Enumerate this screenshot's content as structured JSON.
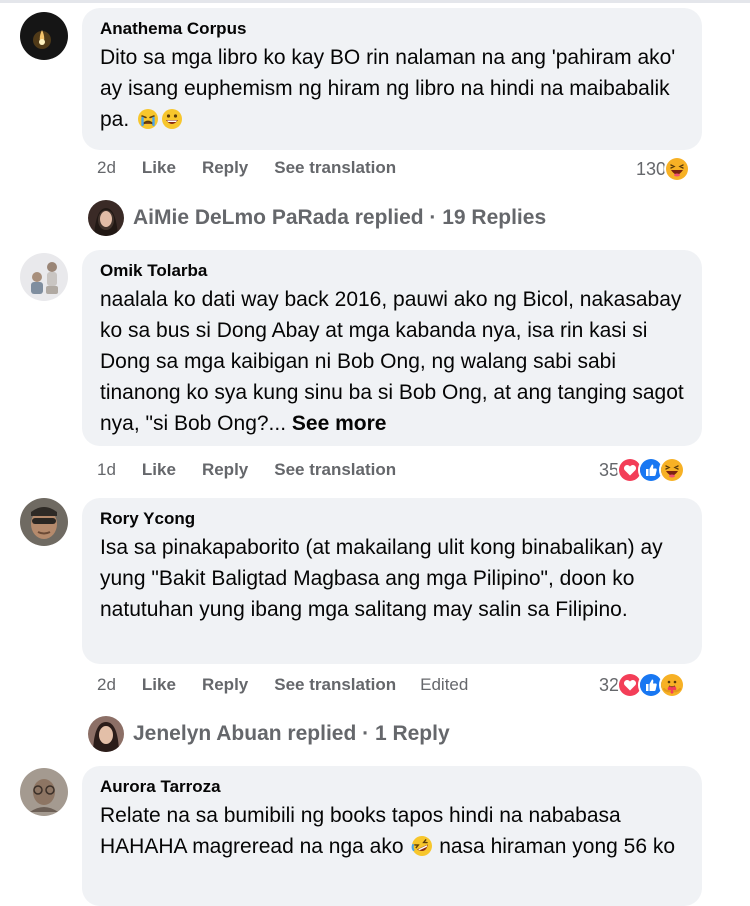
{
  "comments": [
    {
      "author": "Anathema Corpus",
      "text": "Dito sa mga libro ko kay BO rin nalaman na ang 'pahiram ako' ay isang euphemism ng hiram ng libro na hindi na maibabalik pa.",
      "text_emojis": [
        "crying-face",
        "grinning-face"
      ],
      "time": "2d",
      "like_label": "Like",
      "reply_label": "Reply",
      "translate_label": "See translation",
      "reaction_count": "130",
      "reactions": [
        "haha"
      ],
      "replies_summary": "AiMie DeLmo PaRada replied · 19 Replies"
    },
    {
      "author": "Omik Tolarba",
      "text": "naalala ko dati way back 2016, pauwi ako ng Bicol, nakasabay ko sa bus si Dong Abay at mga kabanda nya, isa rin kasi si Dong sa mga kaibigan ni Bob Ong, ng walang sabi sabi tinanong ko sya kung sinu ba si Bob Ong, at ang tanging sagot nya, \"si Bob Ong?...",
      "see_more": "See more",
      "time": "1d",
      "like_label": "Like",
      "reply_label": "Reply",
      "translate_label": "See translation",
      "reaction_count": "35",
      "reactions": [
        "love",
        "like",
        "haha"
      ]
    },
    {
      "author": "Rory Ycong",
      "text": "Isa sa pinakapaborito (at makailang ulit kong binabalikan) ay yung \"Bakit Baligtad Magbasa ang mga Pilipino\", doon ko natutuhan yung ibang mga salitang may salin sa Filipino.",
      "time": "2d",
      "like_label": "Like",
      "reply_label": "Reply",
      "translate_label": "See translation",
      "edited_label": "Edited",
      "reaction_count": "32",
      "reactions": [
        "love",
        "like",
        "care"
      ],
      "replies_summary": "Jenelyn Abuan replied · 1 Reply"
    },
    {
      "author": "Aurora Tarroza",
      "text": "Relate na sa bumibili ng books tapos hindi na nababasa HAHAHA magreread na nga ako",
      "text_emoji": "rolling-laughing-face",
      "text_tail": " nasa hiraman yong 56 ko"
    }
  ],
  "colors": {
    "bubble": "#f0f2f5",
    "meta_text": "#65676b",
    "like_blue": "#1877f2",
    "love_red": "#f33e58",
    "haha_yellow": "#f7b125"
  }
}
